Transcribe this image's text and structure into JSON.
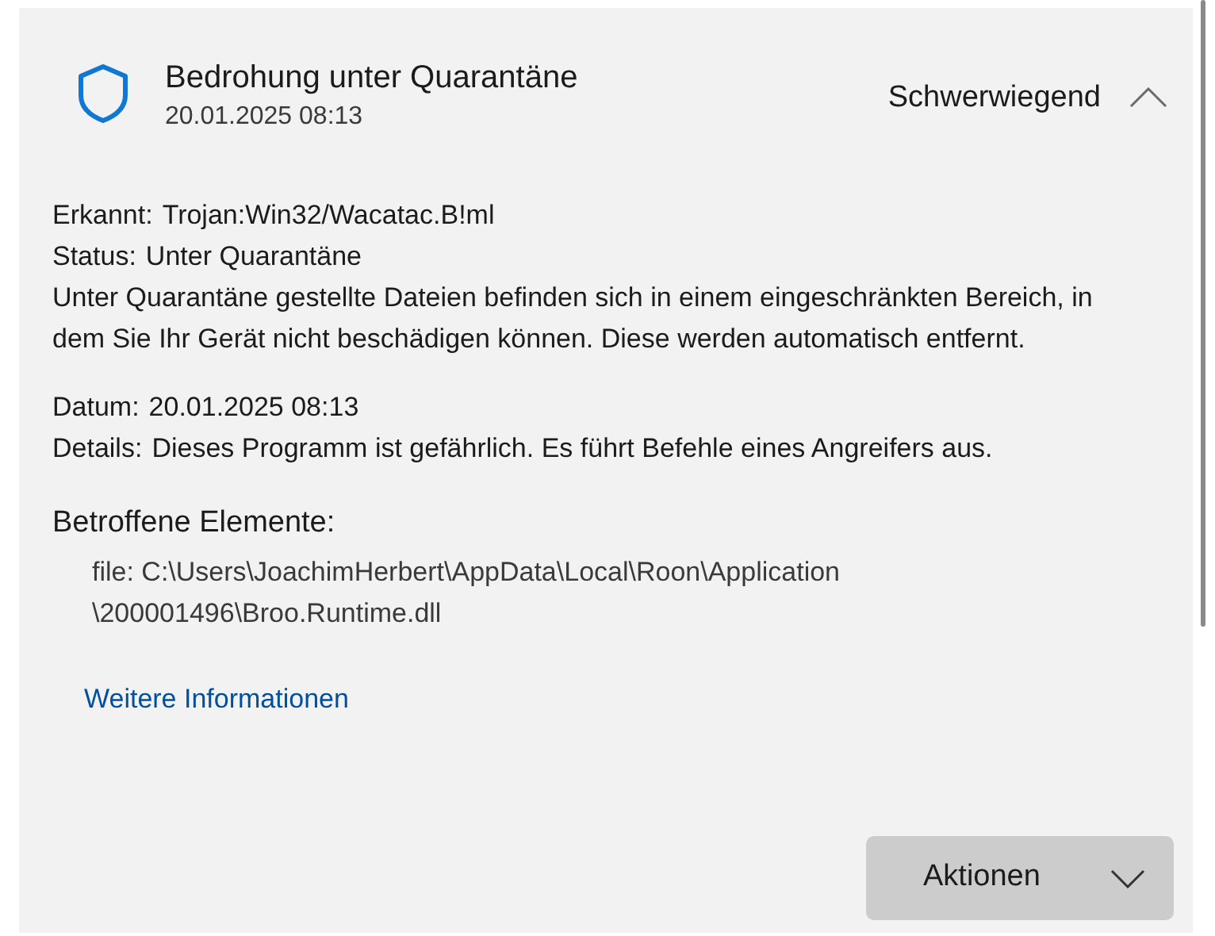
{
  "threat": {
    "title": "Bedrohung unter Quarantäne",
    "date": "20.01.2025 08:13",
    "severity": "Schwerwiegend",
    "expanded": true
  },
  "fields": [
    {
      "label": "Erkannt:",
      "value": "Trojan:Win32/Wacatac.B!ml"
    },
    {
      "label": "Status:",
      "value": "Unter Quarantäne"
    }
  ],
  "description": "Unter Quarantäne gestellte Dateien befinden sich in einem eingeschränkten Bereich, in dem Sie Ihr Gerät nicht beschädigen können. Diese werden automatisch entfernt.",
  "fields_2": [
    {
      "label": "Datum:",
      "value": "20.01.2025 08:13"
    },
    {
      "label": "Details:",
      "value": "Dieses Programm ist gefährlich. Es führt Befehle eines Angreifers aus."
    }
  ],
  "affected": {
    "heading": "Betroffene Elemente:",
    "lines": [
      "file: C:\\Users\\JoachimHerbert\\AppData\\Local\\Roon\\Application",
      "\\200001496\\Broo.Runtime.dll"
    ]
  },
  "link": "Weitere Informationen",
  "actions_button": "Aktionen"
}
